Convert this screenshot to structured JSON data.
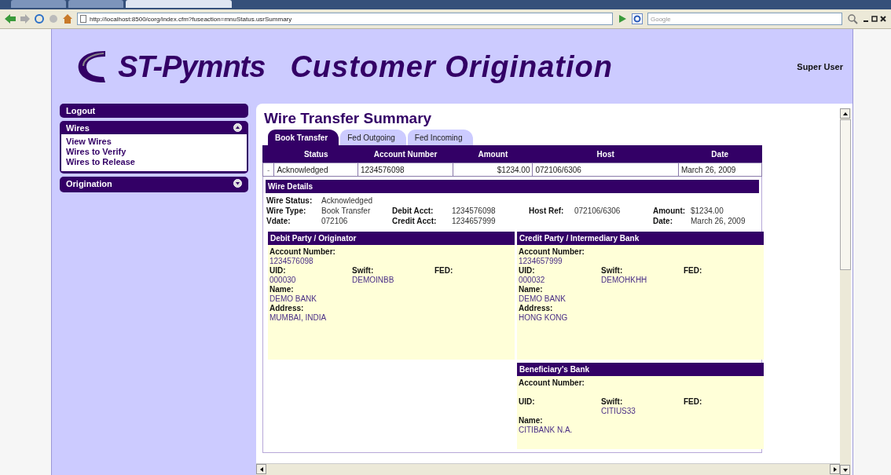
{
  "browser": {
    "tabs": [
      {
        "selected": false
      },
      {
        "selected": false
      },
      {
        "selected": true
      }
    ],
    "url": "http://localhost:8500/corg/index.cfm?fuseaction=mnuStatus.usrSummary",
    "search_placeholder": "Google"
  },
  "header": {
    "logo": "ST-Pymnts",
    "title": "Customer Origination",
    "user": "Super User"
  },
  "sidebar": [
    {
      "kind": "link",
      "label": "Logout"
    },
    {
      "kind": "section",
      "label": "Wires",
      "expanded": true,
      "items": [
        "View Wires",
        "Wires to Verify",
        "Wires to Release"
      ]
    },
    {
      "kind": "section",
      "label": "Origination",
      "expanded": false
    }
  ],
  "page_title": "Wire Transfer Summary",
  "tabs": [
    {
      "label": "Book Transfer",
      "selected": true
    },
    {
      "label": "Fed Outgoing",
      "selected": false
    },
    {
      "label": "Fed Incoming",
      "selected": false
    }
  ],
  "table": {
    "columns": [
      "Status",
      "Account Number",
      "Amount",
      "Host",
      "Date"
    ],
    "rows": [
      {
        "toggle": "-",
        "cells": [
          "Acknowledged",
          "1234576098",
          "$1234.00",
          "072106/6306",
          "March 26, 2009"
        ]
      }
    ]
  },
  "wire_details": {
    "title": "Wire Details",
    "rows": [
      [
        {
          "label": "Wire Status:",
          "value": "Acknowledged"
        },
        null,
        null,
        null
      ],
      [
        {
          "label": "Wire Type:",
          "value": "Book Transfer"
        },
        {
          "label": "Debit Acct:",
          "value": "1234576098"
        },
        {
          "label": "Host Ref:",
          "value": "072106/6306"
        },
        {
          "label": "Amount:",
          "value": "$1234.00"
        }
      ],
      [
        {
          "label": "Vdate:",
          "value": "072106"
        },
        {
          "label": "Credit Acct:",
          "value": "1234657999"
        },
        null,
        {
          "label": "Date:",
          "value": "March 26, 2009"
        }
      ]
    ]
  },
  "parties": [
    {
      "title": "Debit Party / Originator",
      "account_label": "Account Number:",
      "account": "1234576098",
      "uid_label": "UID:",
      "uid": "000030",
      "swift_label": "Swift:",
      "swift": "DEMOINBB",
      "fed_label": "FED:",
      "name_label": "Name:",
      "name": "DEMO BANK",
      "address_label": "Address:",
      "address": "MUMBAI, INDIA"
    },
    {
      "title": "Credit Party / Intermediary Bank",
      "account_label": "Account Number:",
      "account": "1234657999",
      "uid_label": "UID:",
      "uid": "000032",
      "swift_label": "Swift:",
      "swift": "DEMOHKHH",
      "fed_label": "FED:",
      "name_label": "Name:",
      "name": "DEMO BANK",
      "address_label": "Address:",
      "address": "HONG KONG"
    },
    {
      "title": "Beneficiary's Bank",
      "account_label": "Account Number:",
      "uid_label": "UID:",
      "swift_label": "Swift:",
      "swift": "CITIUS33",
      "fed_label": "FED:",
      "name_label": "Name:",
      "name": "CITIBANK N.A."
    }
  ]
}
